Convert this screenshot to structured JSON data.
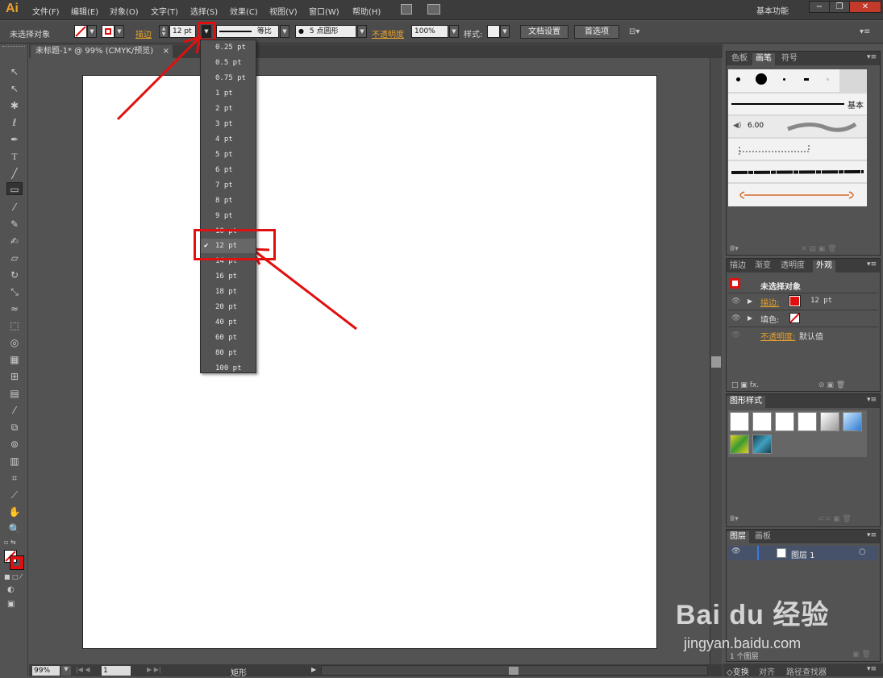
{
  "app": {
    "logo": "Ai",
    "workspace": "基本功能"
  },
  "menu": [
    "文件(F)",
    "编辑(E)",
    "对象(O)",
    "文字(T)",
    "选择(S)",
    "效果(C)",
    "视图(V)",
    "窗口(W)",
    "帮助(H)"
  ],
  "window_controls": [
    "−",
    "❐",
    "✕"
  ],
  "control_bar": {
    "selection": "未选择对象",
    "stroke_label": "描边",
    "stroke_value": "12 pt",
    "profile": "等比",
    "brush": "5 点圆形",
    "opacity_label": "不透明度",
    "opacity_value": "100%",
    "style_label": "样式:",
    "doc_setup": "文档设置",
    "preferences": "首选项"
  },
  "document": {
    "tab": "未标题-1* @ 99% (CMYK/预览)",
    "close": "×"
  },
  "stroke_weight_menu": {
    "items": [
      "0.25 pt",
      "0.5 pt",
      "0.75 pt",
      "1 pt",
      "2 pt",
      "3 pt",
      "4 pt",
      "5 pt",
      "6 pt",
      "7 pt",
      "8 pt",
      "9 pt",
      "10 pt",
      "12 pt",
      "14 pt",
      "16 pt",
      "18 pt",
      "20 pt",
      "40 pt",
      "60 pt",
      "80 pt",
      "100 pt"
    ],
    "selected": "12 pt",
    "check": "✔"
  },
  "brushes_panel": {
    "tabs": [
      "色板",
      "画笔",
      "符号"
    ],
    "basic": "基本",
    "calligraphic_size": "6.00"
  },
  "appearance_panel": {
    "tabs": [
      "描边",
      "渐变",
      "透明度",
      "外观"
    ],
    "title": "未选择对象",
    "stroke_label": "描边:",
    "stroke_value": "12 pt",
    "fill_label": "填色:",
    "opacity_label": "不透明度:",
    "opacity_value": "默认值"
  },
  "graphic_styles_panel": {
    "tabs": [
      "图形样式"
    ]
  },
  "layers_panel": {
    "tabs": [
      "图层",
      "画板"
    ],
    "layer_name": "图层 1",
    "count": "1 个图层"
  },
  "bottom_tabs": [
    "◇变换",
    "对齐",
    "路径查找器"
  ],
  "status": {
    "zoom": "99%",
    "page": "1",
    "tool": "矩形"
  },
  "watermark": {
    "brand": "Bai du 经验",
    "url": "jingyan.baidu.com"
  },
  "colors": {
    "accent_red": "#e01010",
    "orange_label": "#e8a12a"
  }
}
